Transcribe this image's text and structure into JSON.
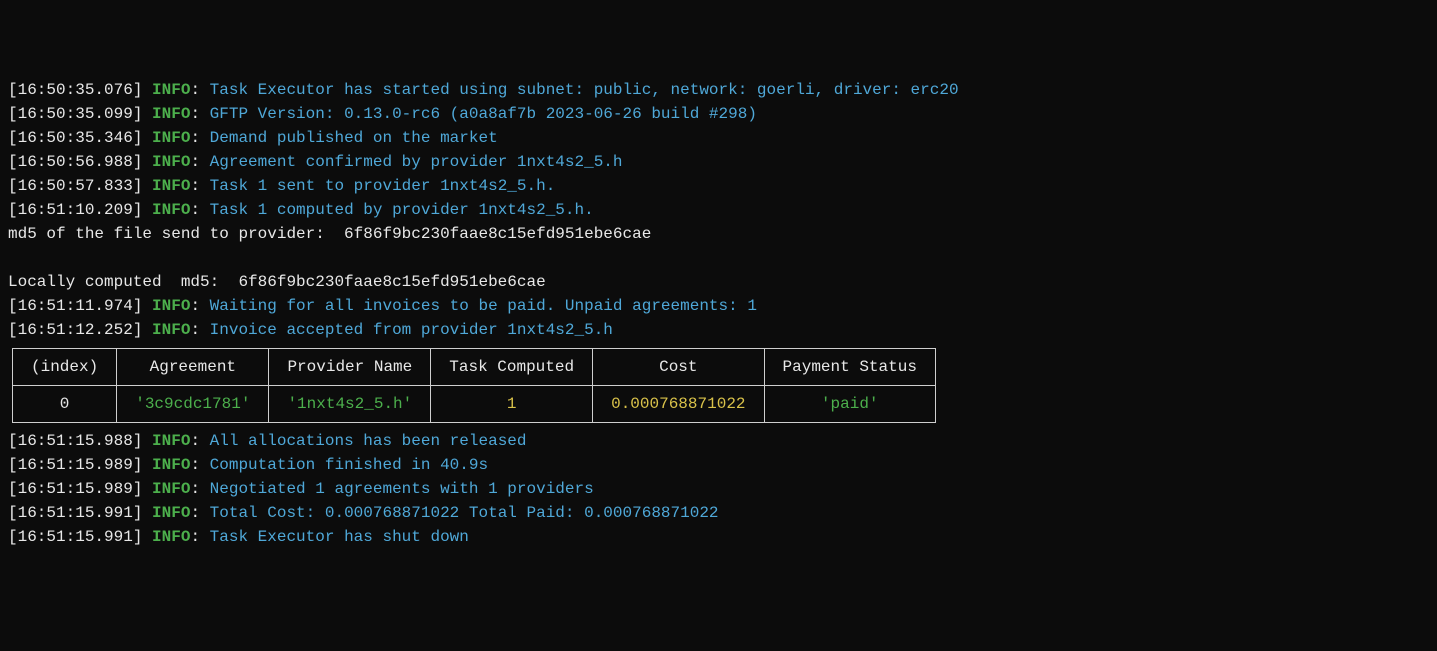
{
  "logs_before": [
    {
      "ts": "[16:50:35.076]",
      "lvl": "INFO",
      "msg": "Task Executor has started using subnet: public, network: goerli, driver: erc20"
    },
    {
      "ts": "[16:50:35.099]",
      "lvl": "INFO",
      "msg": "GFTP Version: 0.13.0-rc6 (a0a8af7b 2023-06-26 build #298)"
    },
    {
      "ts": "[16:50:35.346]",
      "lvl": "INFO",
      "msg": "Demand published on the market"
    },
    {
      "ts": "[16:50:56.988]",
      "lvl": "INFO",
      "msg": "Agreement confirmed by provider 1nxt4s2_5.h"
    },
    {
      "ts": "[16:50:57.833]",
      "lvl": "INFO",
      "msg": "Task 1 sent to provider 1nxt4s2_5.h."
    },
    {
      "ts": "[16:51:10.209]",
      "lvl": "INFO",
      "msg": "Task 1 computed by provider 1nxt4s2_5.h."
    }
  ],
  "plain_1": "md5 of the file send to provider:  6f86f9bc230faae8c15efd951ebe6cae",
  "plain_blank": "",
  "plain_2": "Locally computed  md5:  6f86f9bc230faae8c15efd951ebe6cae",
  "logs_mid": [
    {
      "ts": "[16:51:11.974]",
      "lvl": "INFO",
      "msg": "Waiting for all invoices to be paid. Unpaid agreements: 1"
    },
    {
      "ts": "[16:51:12.252]",
      "lvl": "INFO",
      "msg": "Invoice accepted from provider 1nxt4s2_5.h"
    }
  ],
  "table": {
    "headers": [
      "(index)",
      "Agreement",
      "Provider Name",
      "Task Computed",
      "Cost",
      "Payment Status"
    ],
    "row": {
      "index": "0",
      "agreement": "'3c9cdc1781'",
      "provider": "'1nxt4s2_5.h'",
      "task_computed": "1",
      "cost": "0.000768871022",
      "payment_status": "'paid'"
    }
  },
  "logs_after": [
    {
      "ts": "[16:51:15.988]",
      "lvl": "INFO",
      "msg": "All allocations has been released"
    },
    {
      "ts": "[16:51:15.989]",
      "lvl": "INFO",
      "msg": "Computation finished in 40.9s"
    },
    {
      "ts": "[16:51:15.989]",
      "lvl": "INFO",
      "msg": "Negotiated 1 agreements with 1 providers"
    },
    {
      "ts": "[16:51:15.991]",
      "lvl": "INFO",
      "msg": "Total Cost: 0.000768871022 Total Paid: 0.000768871022"
    },
    {
      "ts": "[16:51:15.991]",
      "lvl": "INFO",
      "msg": "Task Executor has shut down"
    }
  ],
  "colon_sep": ": "
}
